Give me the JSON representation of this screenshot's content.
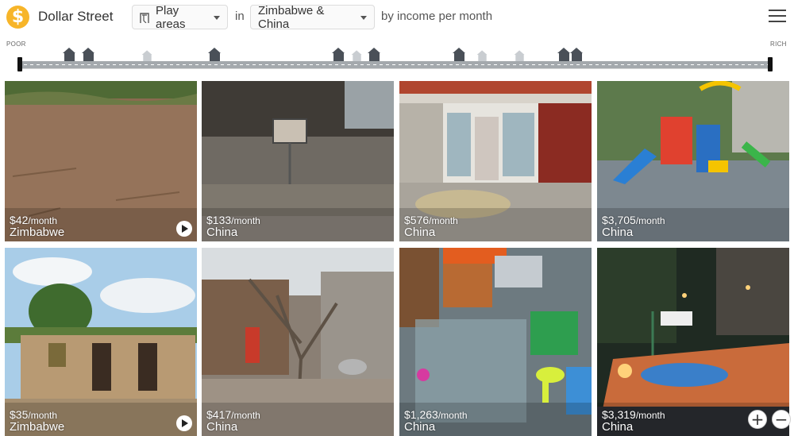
{
  "header": {
    "logo_symbol": "$",
    "brand": "Dollar Street",
    "topic": {
      "icon": "playground-icon",
      "label": "Play areas"
    },
    "in_text": "in",
    "countries": "Zimbabwe & China",
    "by_text": "by income per month",
    "menu_icon": "hamburger-menu-icon"
  },
  "street": {
    "poor_label": "POOR",
    "rich_label": "RICH",
    "houses": [
      {
        "shade": "dark",
        "slot": 0
      },
      {
        "shade": "dark",
        "slot": 1
      },
      {
        "shade": "light",
        "slot": 2
      },
      {
        "shade": "dark",
        "slot": 3
      },
      {
        "shade": "dark",
        "slot": 4
      },
      {
        "shade": "light",
        "slot": 5
      },
      {
        "shade": "dark",
        "slot": 6
      },
      {
        "shade": "dark",
        "slot": 7
      },
      {
        "shade": "light",
        "slot": 8
      },
      {
        "shade": "light",
        "slot": 9
      },
      {
        "shade": "dark",
        "slot": 10
      },
      {
        "shade": "dark",
        "slot": 11
      }
    ]
  },
  "colors": {
    "logo": "#f7b529",
    "house_dark": "#4a5058",
    "house_light": "#c9cdd1",
    "road": "#a4a9ad"
  },
  "cards": [
    {
      "amount": "$42",
      "per": "/month",
      "country": "Zimbabwe",
      "has_video": true
    },
    {
      "amount": "$133",
      "per": "/month",
      "country": "China",
      "has_video": false
    },
    {
      "amount": "$576",
      "per": "/month",
      "country": "China",
      "has_video": false
    },
    {
      "amount": "$3,705",
      "per": "/month",
      "country": "China",
      "has_video": false
    },
    {
      "amount": "$35",
      "per": "/month",
      "country": "Zimbabwe",
      "has_video": true
    },
    {
      "amount": "$417",
      "per": "/month",
      "country": "China",
      "has_video": false
    },
    {
      "amount": "$1,263",
      "per": "/month",
      "country": "China",
      "has_video": false
    },
    {
      "amount": "$3,319",
      "per": "/month",
      "country": "China",
      "has_video": false
    }
  ],
  "zoom": {
    "in_label": "+",
    "out_label": "−"
  }
}
